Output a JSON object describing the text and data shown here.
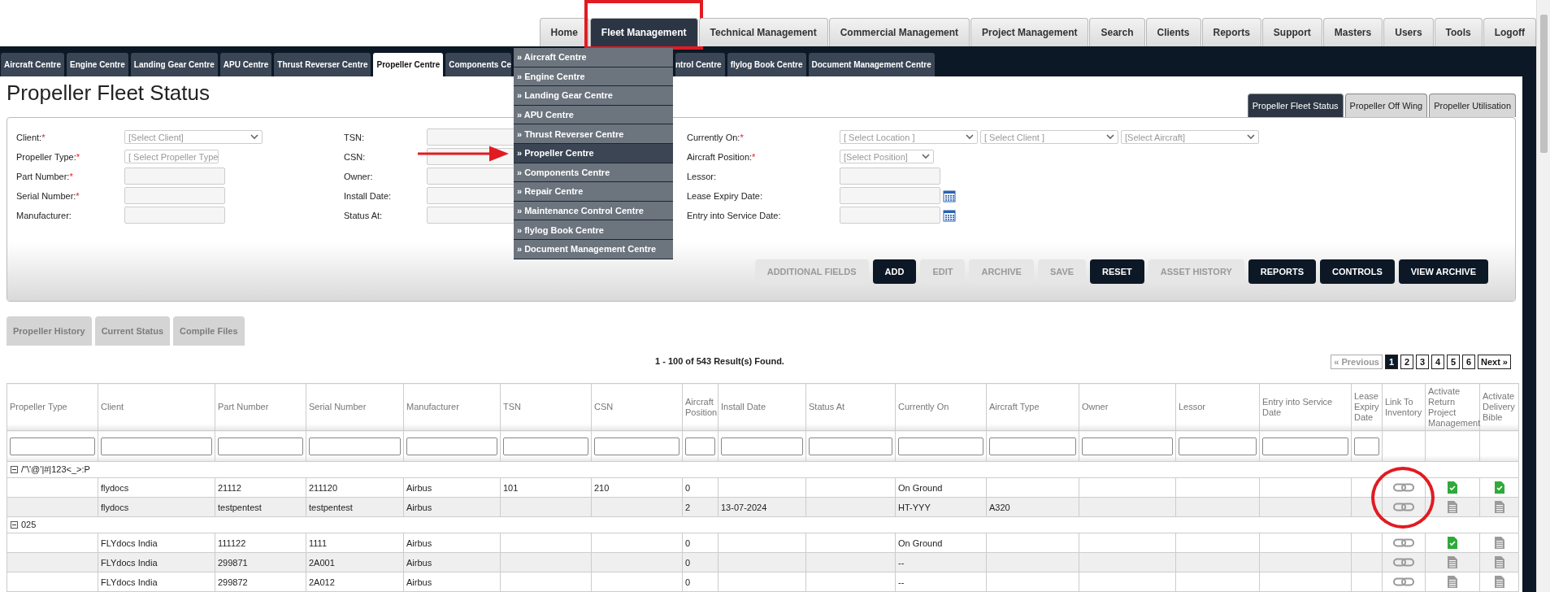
{
  "top_nav": [
    {
      "label": "Home",
      "selected": false,
      "boxed": false
    },
    {
      "label": "Fleet Management",
      "selected": true,
      "boxed": true
    },
    {
      "label": "Technical Management",
      "selected": false,
      "boxed": false
    },
    {
      "label": "Commercial Management",
      "selected": false,
      "boxed": false
    },
    {
      "label": "Project Management",
      "selected": false,
      "boxed": false
    },
    {
      "label": "Search",
      "selected": false,
      "boxed": false
    },
    {
      "label": "Clients",
      "selected": false,
      "boxed": false
    },
    {
      "label": "Reports",
      "selected": false,
      "boxed": false
    },
    {
      "label": "Support",
      "selected": false,
      "boxed": false
    },
    {
      "label": "Masters",
      "selected": false,
      "boxed": false
    },
    {
      "label": "Users",
      "selected": false,
      "boxed": false
    },
    {
      "label": "Tools",
      "selected": false,
      "boxed": false
    },
    {
      "label": "Logoff",
      "selected": false,
      "boxed": false
    }
  ],
  "sub_tabs_before_menu": [
    {
      "label": "Aircraft Centre",
      "selected": false
    },
    {
      "label": "Engine Centre",
      "selected": false
    },
    {
      "label": "Landing Gear Centre",
      "selected": false
    },
    {
      "label": "APU Centre",
      "selected": false
    },
    {
      "label": "Thrust Reverser Centre",
      "selected": false
    },
    {
      "label": "Propeller Centre",
      "selected": true
    },
    {
      "label": "Components Ce",
      "selected": false
    }
  ],
  "sub_tabs_after_menu": [
    {
      "label": "ntrol Centre",
      "selected": false
    },
    {
      "label": "flylog Book Centre",
      "selected": false
    },
    {
      "label": "Document Management Centre",
      "selected": false
    }
  ],
  "dropdown_menu": [
    {
      "label": "» Aircraft Centre",
      "selected": false,
      "pointed": false
    },
    {
      "label": "» Engine Centre",
      "selected": false,
      "pointed": false
    },
    {
      "label": "» Landing Gear Centre",
      "selected": false,
      "pointed": false
    },
    {
      "label": "» APU Centre",
      "selected": false,
      "pointed": false
    },
    {
      "label": "» Thrust Reverser Centre",
      "selected": false,
      "pointed": false
    },
    {
      "label": "» Propeller Centre",
      "selected": true,
      "pointed": true
    },
    {
      "label": "» Components Centre",
      "selected": false,
      "pointed": false
    },
    {
      "label": "» Repair Centre",
      "selected": false,
      "pointed": false
    },
    {
      "label": "» Maintenance Control Centre",
      "selected": false,
      "pointed": false
    },
    {
      "label": "» flylog Book Centre",
      "selected": false,
      "pointed": false
    },
    {
      "label": "» Document Management Centre",
      "selected": false,
      "pointed": false
    }
  ],
  "required_marker": "*",
  "page_title": "Propeller Fleet Status",
  "page_tabs": [
    {
      "label": "Propeller Fleet Status",
      "selected": true
    },
    {
      "label": "Propeller Off Wing",
      "selected": false
    },
    {
      "label": "Propeller Utilisation",
      "selected": false
    }
  ],
  "form": {
    "columns": [
      [
        {
          "label": "Client:",
          "required": true,
          "kind": "select",
          "placeholder": "[Select Client]"
        },
        {
          "label": "Propeller Type:",
          "required": true,
          "kind": "select_small",
          "placeholder": "[ Select Propeller Type"
        },
        {
          "label": "Part Number:",
          "required": true,
          "kind": "input"
        },
        {
          "label": "Serial Number:",
          "required": true,
          "kind": "input"
        },
        {
          "label": "Manufacturer:",
          "required": false,
          "kind": "input"
        }
      ],
      [
        {
          "label": "TSN:",
          "required": false,
          "kind": "input"
        },
        {
          "label": "CSN:",
          "required": false,
          "kind": "input"
        },
        {
          "label": "Owner:",
          "required": false,
          "kind": "input"
        },
        {
          "label": "Install Date:",
          "required": false,
          "kind": "input"
        },
        {
          "label": "Status At:",
          "required": false,
          "kind": "input"
        }
      ],
      [
        {
          "label": "Currently On:",
          "required": true,
          "kind": "selects",
          "selects": [
            "[ Select Location ]",
            "[ Select Client ]",
            "[Select Aircraft]"
          ]
        },
        {
          "label": "Aircraft Position:",
          "required": true,
          "kind": "select_small",
          "placeholder": "[Select Position]"
        },
        {
          "label": "Lessor:",
          "required": false,
          "kind": "input"
        },
        {
          "label": "Lease Expiry Date:",
          "required": false,
          "kind": "date"
        },
        {
          "label": "Entry into Service Date:",
          "required": false,
          "kind": "date"
        }
      ]
    ],
    "buttons": [
      {
        "label": "ADDITIONAL FIELDS",
        "disabled": true
      },
      {
        "label": "ADD",
        "disabled": false
      },
      {
        "label": "EDIT",
        "disabled": true
      },
      {
        "label": "ARCHIVE",
        "disabled": true
      },
      {
        "label": "SAVE",
        "disabled": true
      },
      {
        "label": "RESET",
        "disabled": false
      },
      {
        "label": "ASSET HISTORY",
        "disabled": true
      },
      {
        "label": "REPORTS",
        "disabled": false
      },
      {
        "label": "CONTROLS",
        "disabled": false
      },
      {
        "label": "VIEW ARCHIVE",
        "disabled": false
      }
    ]
  },
  "action_buttons": [
    {
      "label": "Propeller History",
      "disabled": true
    },
    {
      "label": "Current Status",
      "disabled": true
    },
    {
      "label": "Compile Files",
      "disabled": true
    }
  ],
  "results_text": "1 - 100 of 543 Result(s) Found.",
  "pagination": [
    {
      "label": "« Previous",
      "disabled": true,
      "selected": false
    },
    {
      "label": "1",
      "disabled": false,
      "selected": true
    },
    {
      "label": "2",
      "disabled": false,
      "selected": false
    },
    {
      "label": "3",
      "disabled": false,
      "selected": false
    },
    {
      "label": "4",
      "disabled": false,
      "selected": false
    },
    {
      "label": "5",
      "disabled": false,
      "selected": false
    },
    {
      "label": "6",
      "disabled": false,
      "selected": false
    },
    {
      "label": "Next »",
      "disabled": false,
      "selected": false
    }
  ],
  "table": {
    "columns": [
      {
        "label": "Propeller Type",
        "filter": true
      },
      {
        "label": "Client",
        "filter": true
      },
      {
        "label": "Part Number",
        "filter": true
      },
      {
        "label": "Serial Number",
        "filter": true
      },
      {
        "label": "Manufacturer",
        "filter": true
      },
      {
        "label": "TSN",
        "filter": true
      },
      {
        "label": "CSN",
        "filter": true
      },
      {
        "label": "Aircraft Position",
        "filter": true
      },
      {
        "label": "Install Date",
        "filter": true
      },
      {
        "label": "Status At",
        "filter": true
      },
      {
        "label": "Currently On",
        "filter": true
      },
      {
        "label": "Aircraft Type",
        "filter": true
      },
      {
        "label": "Owner",
        "filter": true
      },
      {
        "label": "Lessor",
        "filter": true
      },
      {
        "label": "Entry into Service Date",
        "filter": true
      },
      {
        "label": "Lease Expiry Date",
        "filter": true
      },
      {
        "label": "Link To Inventory",
        "filter": false
      },
      {
        "label": "Activate Return Project Management",
        "filter": false
      },
      {
        "label": "Activate Delivery Bible",
        "filter": false
      }
    ],
    "groups": [
      {
        "label": "/\"\\'@'|#|123<_>:P",
        "expanded": true,
        "rows": [
          {
            "cells": [
              null,
              "flydocs",
              "21112",
              "211120",
              "Airbus",
              "101",
              "210",
              "0",
              null,
              null,
              "On Ground",
              null,
              null,
              null,
              null,
              null
            ],
            "circled": true,
            "return_active": true,
            "bible_active": true
          },
          {
            "cells": [
              null,
              "flydocs",
              "testpentest",
              "testpentest",
              "Airbus",
              null,
              null,
              "2",
              "13-07-2024",
              null,
              "HT-YYY",
              "A320",
              null,
              null,
              null,
              null
            ],
            "circled": true,
            "return_active": false,
            "bible_active": false
          }
        ]
      },
      {
        "label": "025",
        "expanded": true,
        "rows": [
          {
            "cells": [
              null,
              "FLYdocs India",
              "111122",
              "1111",
              "Airbus",
              null,
              null,
              "0",
              null,
              null,
              "On Ground",
              null,
              null,
              null,
              null,
              null
            ],
            "circled": false,
            "return_active": true,
            "bible_active": false
          },
          {
            "cells": [
              null,
              "FLYdocs India",
              "299871",
              "2A001",
              "Airbus",
              null,
              null,
              "0",
              null,
              null,
              "--",
              null,
              null,
              null,
              null,
              null
            ],
            "circled": false,
            "return_active": false,
            "bible_active": false
          },
          {
            "cells": [
              null,
              "FLYdocs India",
              "299872",
              "2A012",
              "Airbus",
              null,
              null,
              "0",
              null,
              null,
              "--",
              null,
              null,
              null,
              null,
              null
            ],
            "circled": false,
            "return_active": false,
            "bible_active": false
          }
        ]
      }
    ]
  }
}
